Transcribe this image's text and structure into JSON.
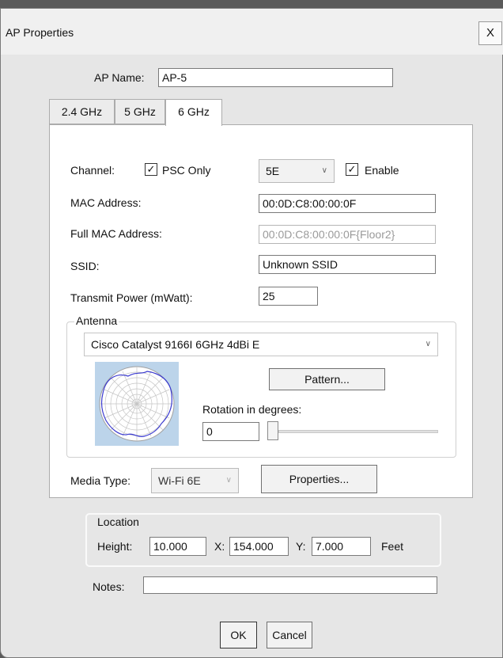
{
  "window": {
    "title": "AP Properties",
    "close_label": "X"
  },
  "ap_name": {
    "label": "AP Name:",
    "value": "AP-5"
  },
  "tabs": [
    {
      "label": "2.4 GHz",
      "selected": false
    },
    {
      "label": "5 GHz",
      "selected": false
    },
    {
      "label": "6 GHz",
      "selected": true
    }
  ],
  "channel": {
    "label": "Channel:",
    "psc_only_label": "PSC Only",
    "psc_only_checked": true,
    "value": "5E",
    "enable_label": "Enable",
    "enable_checked": true
  },
  "mac_address": {
    "label": "MAC Address:",
    "value": "00:0D:C8:00:00:0F"
  },
  "full_mac_address": {
    "label": "Full MAC Address:",
    "value": "00:0D:C8:00:00:0F{Floor2}"
  },
  "ssid": {
    "label": "SSID:",
    "value": "Unknown SSID"
  },
  "transmit_power": {
    "label": "Transmit Power (mWatt):",
    "value": "25"
  },
  "antenna": {
    "group_label": "Antenna",
    "model": "Cisco Catalyst 9166I 6GHz 4dBi E",
    "pattern_button": "Pattern...",
    "rotation_label": "Rotation in degrees:",
    "rotation_value": "0",
    "rotation_slider_fraction": 0
  },
  "media_type": {
    "label": "Media Type:",
    "value": "Wi-Fi 6E",
    "properties_button": "Properties..."
  },
  "location": {
    "group_label": "Location",
    "height_label": "Height:",
    "height_value": "10.000",
    "x_label": "X:",
    "x_value": "154.000",
    "y_label": "Y:",
    "y_value": "7.000",
    "unit_label": "Feet"
  },
  "notes": {
    "label": "Notes:",
    "value": ""
  },
  "buttons": {
    "ok": "OK",
    "cancel": "Cancel"
  },
  "colors": {
    "accent_check": "#111111",
    "pattern_line": "#3a3ad0",
    "pattern_bg": "#bcd4ea"
  }
}
